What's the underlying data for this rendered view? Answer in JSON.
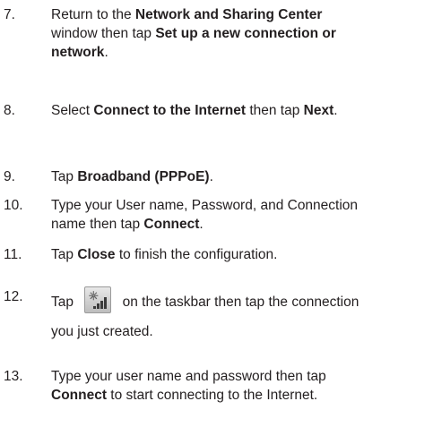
{
  "steps": [
    {
      "number": "7.",
      "lines": [
        [
          "Return to the ",
          {
            "b": "Network and Sharing Center"
          }
        ],
        [
          "window then tap ",
          {
            "b": "Set up a new connection or"
          }
        ],
        [
          {
            "b": "network"
          },
          "."
        ]
      ]
    },
    {
      "number": "8.",
      "lines": [
        [
          "Select ",
          {
            "b": "Connect to the Internet"
          },
          " then tap ",
          {
            "b": "Next"
          },
          "."
        ]
      ]
    },
    {
      "number": "9.",
      "lines": [
        [
          "Tap ",
          {
            "b": "Broadband (PPPoE)"
          },
          "."
        ]
      ]
    },
    {
      "number": "10.",
      "lines": [
        [
          "Type your User name, Password, and Connection"
        ],
        [
          "name then tap ",
          {
            "b": "Connect"
          },
          "."
        ]
      ]
    },
    {
      "number": "11.",
      "lines": [
        [
          "Tap ",
          {
            "b": "Close"
          },
          " to finish the configuration."
        ]
      ]
    },
    {
      "number": "12.",
      "lines": [
        [
          "Tap ",
          {
            "icon": "network-taskbar-icon"
          },
          " on the taskbar then tap the connection"
        ],
        [
          "you just created."
        ]
      ]
    },
    {
      "number": "13.",
      "lines": [
        [
          "Type your user name and password then tap"
        ],
        [
          {
            "b": "Connect"
          },
          " to start connecting to the Internet."
        ]
      ]
    }
  ]
}
